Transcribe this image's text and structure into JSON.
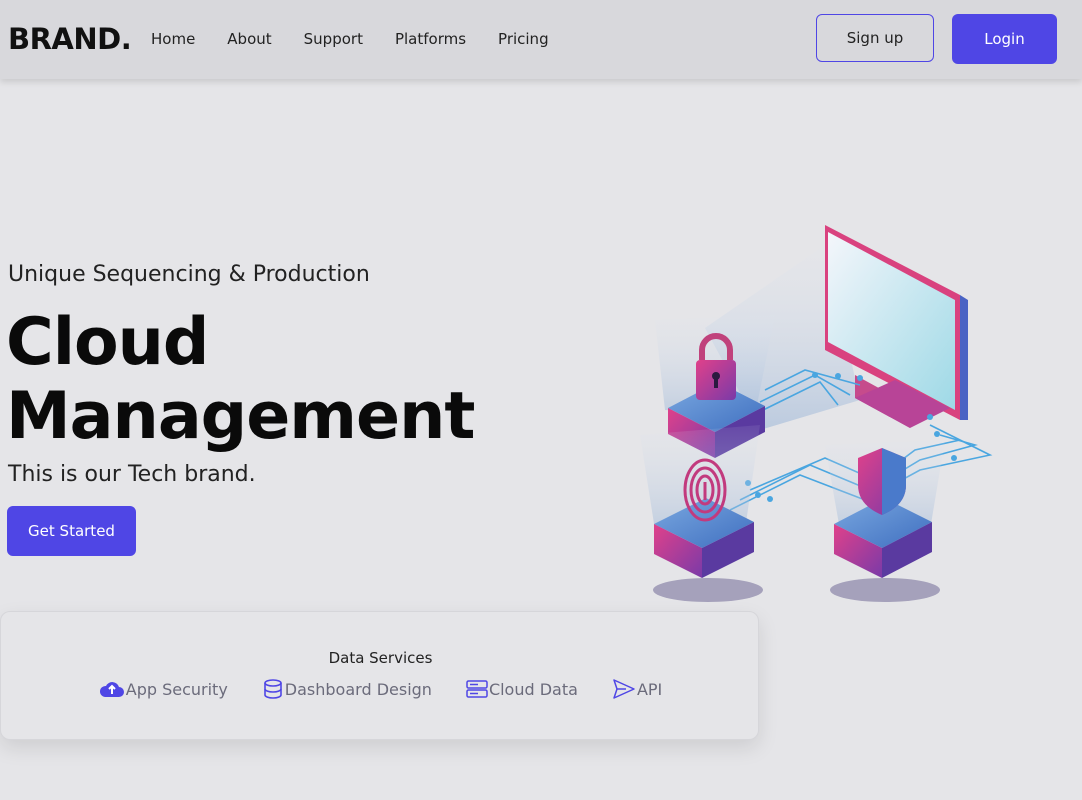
{
  "brand": "BRAND.",
  "nav": {
    "links": [
      "Home",
      "About",
      "Support",
      "Platforms",
      "Pricing"
    ],
    "signup_label": "Sign up",
    "login_label": "Login"
  },
  "hero": {
    "kicker": "Unique Sequencing & Production",
    "title_line1": "Cloud",
    "title_line2": "Management",
    "subtitle": "This is our Tech brand.",
    "cta_label": "Get Started"
  },
  "services": {
    "title": "Data Services",
    "items": [
      {
        "label": "App Security",
        "icon": "cloud-upload-icon"
      },
      {
        "label": "Dashboard Design",
        "icon": "database-icon"
      },
      {
        "label": "Cloud Data",
        "icon": "server-icon"
      },
      {
        "label": "API",
        "icon": "send-icon"
      }
    ]
  },
  "colors": {
    "accent": "#4f46e5",
    "background": "#e5e5e8",
    "navbar": "#d8d8dc",
    "service_text": "#6b6b7b"
  }
}
